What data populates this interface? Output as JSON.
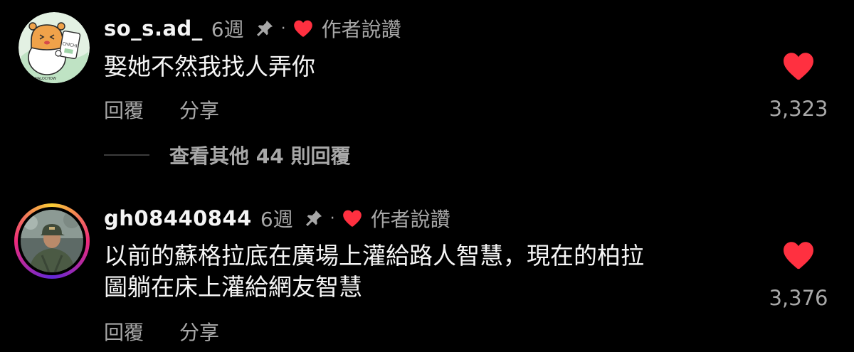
{
  "comments": [
    {
      "username": "so_s.ad_",
      "time": "6週",
      "pin_icon": "pin-icon",
      "separator": "·",
      "creator_label": "作者說讚",
      "text": "娶她不然我找人弄你",
      "reply_label": "回覆",
      "share_label": "分享",
      "like_count": "3,323",
      "view_replies": "查看其他 44 則回覆",
      "avatar_badge": "CHICHI",
      "avatar_caption": "HALOCHOW"
    },
    {
      "username": "gh08440844",
      "time": "6週",
      "pin_icon": "pin-icon",
      "separator": "·",
      "creator_label": "作者說讚",
      "text_line1": "以前的蘇格拉底在廣場上灌給路人智慧，現在的柏拉",
      "text_line2": "圖躺在床上灌給網友智慧",
      "reply_label": "回覆",
      "share_label": "分享",
      "like_count": "3,376"
    }
  ],
  "colors": {
    "background": "#000000",
    "text_primary": "#f5f5f5",
    "text_secondary": "#a8a8a8",
    "heart": "#ff3040"
  }
}
